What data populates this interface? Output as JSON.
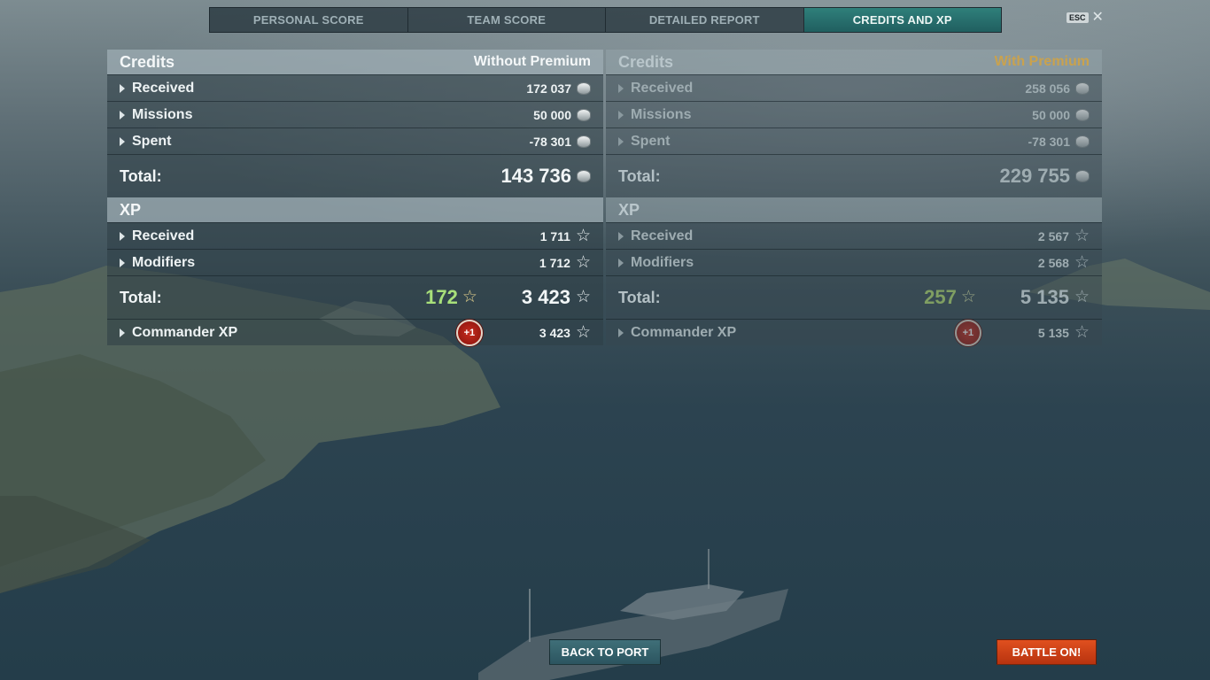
{
  "tabs": [
    {
      "label": "PERSONAL SCORE",
      "active": false
    },
    {
      "label": "TEAM SCORE",
      "active": false
    },
    {
      "label": "DETAILED REPORT",
      "active": false
    },
    {
      "label": "CREDITS AND XP",
      "active": true
    }
  ],
  "esc": {
    "key": "ESC",
    "close": "✕"
  },
  "without_premium": {
    "credits_title": "Credits",
    "mode": "Without Premium",
    "credits_rows": [
      {
        "label": "Received",
        "value": "172 037"
      },
      {
        "label": "Missions",
        "value": "50 000"
      },
      {
        "label": "Spent",
        "value": "-78 301"
      }
    ],
    "credits_total_label": "Total:",
    "credits_total": "143 736",
    "xp_title": "XP",
    "xp_rows": [
      {
        "label": "Received",
        "value": "1 711"
      },
      {
        "label": "Modifiers",
        "value": "1 712"
      }
    ],
    "xp_total_label": "Total:",
    "xp_bonus": "172",
    "xp_total": "3 423",
    "commander_label": "Commander XP",
    "commander_badge": "+1",
    "commander_value": "3 423"
  },
  "with_premium": {
    "credits_title": "Credits",
    "mode": "With Premium",
    "credits_rows": [
      {
        "label": "Received",
        "value": "258 056"
      },
      {
        "label": "Missions",
        "value": "50 000"
      },
      {
        "label": "Spent",
        "value": "-78 301"
      }
    ],
    "credits_total_label": "Total:",
    "credits_total": "229 755",
    "xp_title": "XP",
    "xp_rows": [
      {
        "label": "Received",
        "value": "2 567"
      },
      {
        "label": "Modifiers",
        "value": "2 568"
      }
    ],
    "xp_total_label": "Total:",
    "xp_bonus": "257",
    "xp_total": "5 135",
    "commander_label": "Commander XP",
    "commander_badge": "+1",
    "commander_value": "5 135"
  },
  "buttons": {
    "back": "BACK TO PORT",
    "battle": "BATTLE ON!"
  },
  "icons": {
    "currency": "credits-coin-icon",
    "xp": "star-icon",
    "row_toggle": "caret-right-icon"
  },
  "colors": {
    "active_tab": "#2f7f7a",
    "bonus_xp": "#a8e07a",
    "premium_label": "#c9a24e",
    "battle_button": "#d9461a"
  }
}
